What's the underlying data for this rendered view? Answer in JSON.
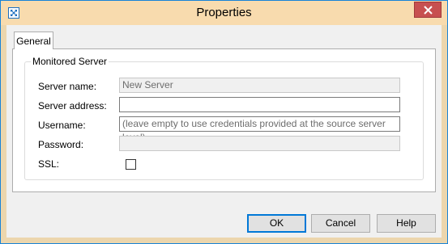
{
  "window": {
    "title": "Properties",
    "app_icon": "move-arrows-icon",
    "close_icon": "close-icon",
    "accent_color": "#1883d7",
    "titlebar_color": "#f8dbae",
    "close_color": "#c75050"
  },
  "tabs": [
    {
      "label": "General",
      "active": true
    }
  ],
  "group": {
    "label": "Monitored Server",
    "fields": {
      "server_name": {
        "label": "Server name:",
        "value": "New Server",
        "enabled": false
      },
      "server_address": {
        "label": "Server address:",
        "value": "",
        "enabled": true
      },
      "username": {
        "label": "Username:",
        "placeholder": "(leave empty to use credentials provided at the source server level)",
        "value": "",
        "enabled": true
      },
      "password": {
        "label": "Password:",
        "value": "",
        "enabled": false
      },
      "ssl": {
        "label": "SSL:",
        "checked": false
      }
    }
  },
  "buttons": {
    "ok": "OK",
    "cancel": "Cancel",
    "help": "Help"
  }
}
